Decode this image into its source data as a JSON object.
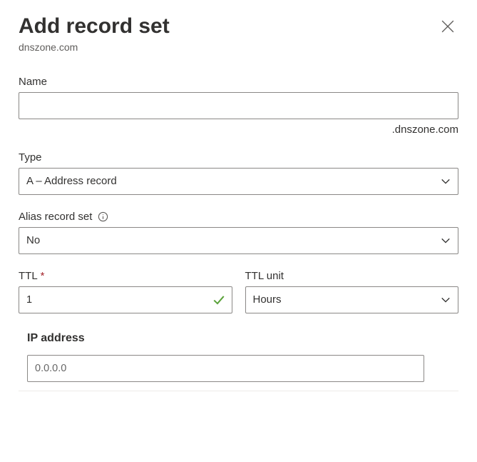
{
  "header": {
    "title": "Add record set",
    "subtitle": "dnszone.com"
  },
  "name": {
    "label": "Name",
    "value": "",
    "suffix": ".dnszone.com"
  },
  "type": {
    "label": "Type",
    "selected": "A – Address record"
  },
  "alias": {
    "label": "Alias record set",
    "selected": "No"
  },
  "ttl": {
    "label": "TTL",
    "value": "1",
    "valid": true
  },
  "ttl_unit": {
    "label": "TTL unit",
    "selected": "Hours"
  },
  "ip": {
    "heading": "IP address",
    "placeholder": "0.0.0.0",
    "value": ""
  }
}
